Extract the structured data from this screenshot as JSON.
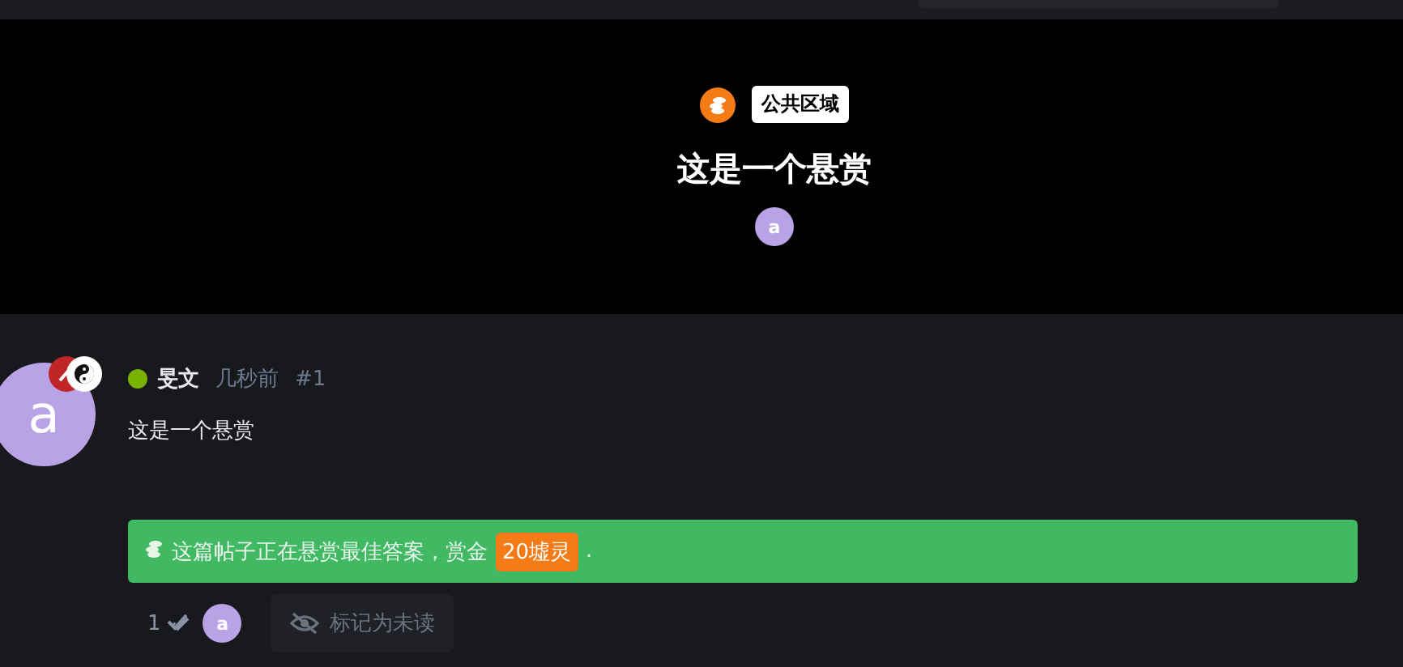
{
  "hero": {
    "tag": "公共区域",
    "title": "这是一个悬赏",
    "author_initial": "a"
  },
  "post": {
    "avatar_initial": "a",
    "online": true,
    "author": "旻文",
    "time": "几秒前",
    "number": "#1",
    "body": "这是一个悬赏",
    "bounty": {
      "text": "这篇帖子正在悬赏最佳答案，赏金",
      "amount": "20墟灵",
      "after": "."
    },
    "read_count": "1",
    "reader_initial": "a",
    "mark_unread": "标记为未读"
  }
}
